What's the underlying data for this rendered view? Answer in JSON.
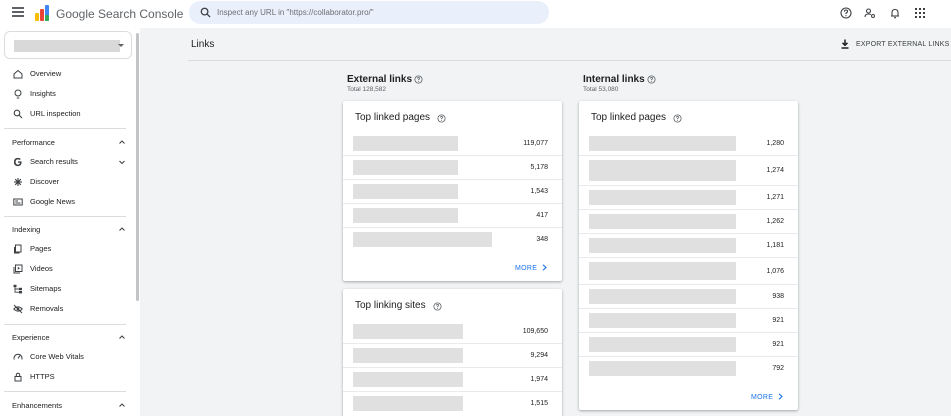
{
  "app": {
    "product_name": "Google Search Console",
    "search_placeholder": "Inspect any URL in \"https://collaborator.pro/\"",
    "brand_colors": {
      "blue": "#4285f4",
      "red": "#ea4335",
      "yellow": "#fbbc04",
      "green": "#34a853"
    }
  },
  "sidebar": {
    "items": [
      {
        "label": "Overview",
        "icon": "home-icon"
      },
      {
        "label": "Insights",
        "icon": "lightbulb-icon"
      },
      {
        "label": "URL inspection",
        "icon": "search-icon"
      }
    ],
    "sections": [
      {
        "label": "Performance",
        "items": [
          {
            "label": "Search results",
            "icon": "google-g-icon"
          },
          {
            "label": "Discover",
            "icon": "asterisk-icon"
          },
          {
            "label": "Google News",
            "icon": "news-icon"
          }
        ]
      },
      {
        "label": "Indexing",
        "items": [
          {
            "label": "Pages",
            "icon": "pages-icon"
          },
          {
            "label": "Videos",
            "icon": "video-icon"
          },
          {
            "label": "Sitemaps",
            "icon": "sitemap-icon"
          },
          {
            "label": "Removals",
            "icon": "eye-off-icon"
          }
        ]
      },
      {
        "label": "Experience",
        "items": [
          {
            "label": "Core Web Vitals",
            "icon": "speed-icon"
          },
          {
            "label": "HTTPS",
            "icon": "lock-icon"
          }
        ]
      },
      {
        "label": "Enhancements",
        "items": []
      }
    ]
  },
  "main": {
    "title": "Links",
    "export_label": "EXPORT EXTERNAL LINKS",
    "external": {
      "title": "External links",
      "total": "Total 128,582",
      "top_linked_pages": {
        "title": "Top linked pages",
        "values": [
          "119,077",
          "5,178",
          "1,543",
          "417",
          "348"
        ],
        "more": "MORE"
      },
      "top_linking_sites": {
        "title": "Top linking sites",
        "values": [
          "109,650",
          "9,294",
          "1,974",
          "1,515"
        ]
      }
    },
    "internal": {
      "title": "Internal links",
      "total": "Total 53,080",
      "top_linked_pages": {
        "title": "Top linked pages",
        "values": [
          "1,280",
          "1,274",
          "1,271",
          "1,262",
          "1,181",
          "1,076",
          "938",
          "921",
          "921",
          "792"
        ],
        "more": "MORE"
      }
    }
  }
}
